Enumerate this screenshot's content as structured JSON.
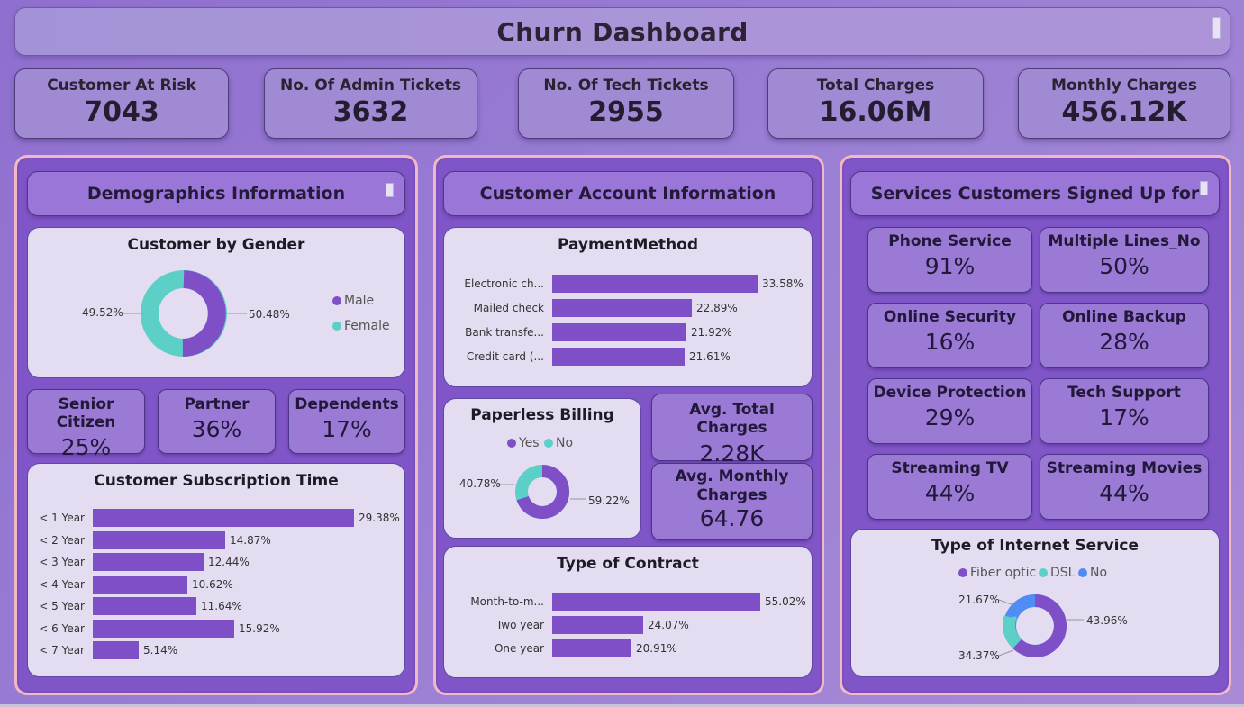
{
  "title": "Churn Dashboard",
  "colors": {
    "accent": "#7f4fc8",
    "teal": "#5ccfc7",
    "blue": "#4f8df5",
    "panel_border": "#f2b8c6"
  },
  "kpis": [
    {
      "label": "Customer At Risk",
      "value": "7043"
    },
    {
      "label": "No. Of Admin Tickets",
      "value": "3632"
    },
    {
      "label": "No. Of Tech Tickets",
      "value": "2955"
    },
    {
      "label": "Total Charges",
      "value": "16.06M"
    },
    {
      "label": "Monthly Charges",
      "value": "456.12K"
    }
  ],
  "demographics": {
    "header": "Demographics Information",
    "gender": {
      "title": "Customer by Gender",
      "male_label": "50.48%",
      "female_label": "49.52%",
      "legend": [
        "Male",
        "Female"
      ]
    },
    "tiles": [
      {
        "label": "Senior Citizen",
        "value": "25%"
      },
      {
        "label": "Partner",
        "value": "36%"
      },
      {
        "label": "Dependents",
        "value": "17%"
      }
    ],
    "subscription": {
      "title": "Customer Subscription Time"
    }
  },
  "account": {
    "header": "Customer Account Information",
    "payment": {
      "title": "PaymentMethod"
    },
    "paperless": {
      "title": "Paperless Billing",
      "legend": [
        "Yes",
        "No"
      ],
      "yes_label": "59.22%",
      "no_label": "40.78%"
    },
    "avg_total": {
      "label": "Avg. Total Charges",
      "value": "2.28K"
    },
    "avg_monthly": {
      "label": "Avg. Monthly Charges",
      "value": "64.76"
    },
    "contract": {
      "title": "Type of Contract"
    }
  },
  "services": {
    "header": "Services Customers Signed Up for",
    "tiles": [
      {
        "label": "Phone Service",
        "value": "91%"
      },
      {
        "label": "Multiple Lines_No",
        "value": "50%"
      },
      {
        "label": "Online Security",
        "value": "16%"
      },
      {
        "label": "Online Backup",
        "value": "28%"
      },
      {
        "label": "Device Protection",
        "value": "29%"
      },
      {
        "label": "Tech Support",
        "value": "17%"
      },
      {
        "label": "Streaming TV",
        "value": "44%"
      },
      {
        "label": "Streaming Movies",
        "value": "44%"
      }
    ],
    "internet": {
      "title": "Type of Internet Service",
      "legend": [
        "Fiber optic",
        "DSL",
        "No"
      ],
      "fiber_label": "43.96%",
      "dsl_label": "34.37%",
      "no_label": "21.67%"
    }
  },
  "chart_data": [
    {
      "type": "pie",
      "title": "Customer by Gender",
      "categories": [
        "Male",
        "Female"
      ],
      "values": [
        50.48,
        49.52
      ]
    },
    {
      "type": "bar",
      "title": "Customer Subscription Time",
      "categories": [
        "< 1 Year",
        "< 2 Year",
        "< 3 Year",
        "< 4 Year",
        "< 5 Year",
        "< 6 Year",
        "< 7 Year"
      ],
      "values": [
        29.38,
        14.87,
        12.44,
        10.62,
        11.64,
        15.92,
        5.14
      ],
      "labels": [
        "29.38%",
        "14.87%",
        "12.44%",
        "10.62%",
        "11.64%",
        "15.92%",
        "5.14%"
      ]
    },
    {
      "type": "bar",
      "title": "PaymentMethod",
      "categories": [
        "Electronic ch...",
        "Mailed check",
        "Bank transfe...",
        "Credit card (..."
      ],
      "values": [
        33.58,
        22.89,
        21.92,
        21.61
      ],
      "labels": [
        "33.58%",
        "22.89%",
        "21.92%",
        "21.61%"
      ]
    },
    {
      "type": "pie",
      "title": "Paperless Billing",
      "categories": [
        "Yes",
        "No"
      ],
      "values": [
        59.22,
        40.78
      ]
    },
    {
      "type": "bar",
      "title": "Type of Contract",
      "categories": [
        "Month-to-m...",
        "Two year",
        "One year"
      ],
      "values": [
        55.02,
        24.07,
        20.91
      ],
      "labels": [
        "55.02%",
        "24.07%",
        "20.91%"
      ]
    },
    {
      "type": "pie",
      "title": "Type of Internet Service",
      "categories": [
        "Fiber optic",
        "DSL",
        "No"
      ],
      "values": [
        43.96,
        34.37,
        21.67
      ]
    }
  ]
}
